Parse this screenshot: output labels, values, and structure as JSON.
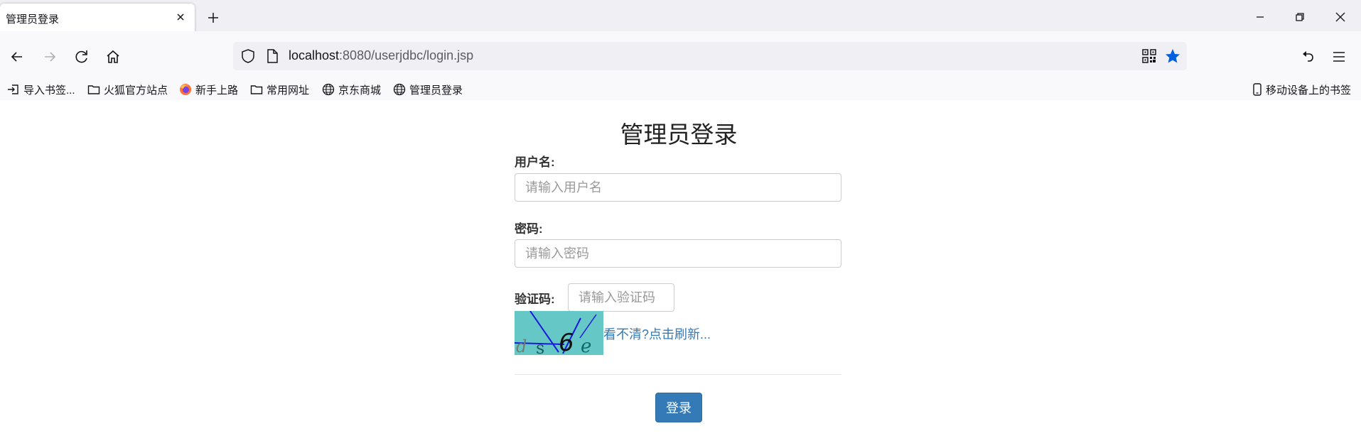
{
  "browser": {
    "tab_title": "管理员登录",
    "url_host": "localhost",
    "url_rest": ":8080/userjdbc/login.jsp",
    "bookmarks": [
      {
        "label": "导入书签...",
        "icon": "import-icon"
      },
      {
        "label": "火狐官方站点",
        "icon": "folder-icon"
      },
      {
        "label": "新手上路",
        "icon": "firefox-icon"
      },
      {
        "label": "常用网址",
        "icon": "folder-icon"
      },
      {
        "label": "京东商城",
        "icon": "globe-icon"
      },
      {
        "label": "管理员登录",
        "icon": "globe-icon"
      }
    ],
    "mobile_bookmarks": "移动设备上的书签",
    "accent_color": "#0060df"
  },
  "page": {
    "title": "管理员登录",
    "username_label": "用户名:",
    "username_placeholder": "请输入用户名",
    "password_label": "密码:",
    "password_placeholder": "请输入密码",
    "captcha_label": "验证码:",
    "captcha_placeholder": "请输入验证码",
    "captcha_chars": [
      "d",
      "s",
      "6",
      "e"
    ],
    "refresh_link": "看不清?点击刷新...",
    "submit_label": "登录",
    "button_color": "#337ab7",
    "link_color": "#337ab7",
    "captcha_bg_color": "#66c7c7"
  }
}
